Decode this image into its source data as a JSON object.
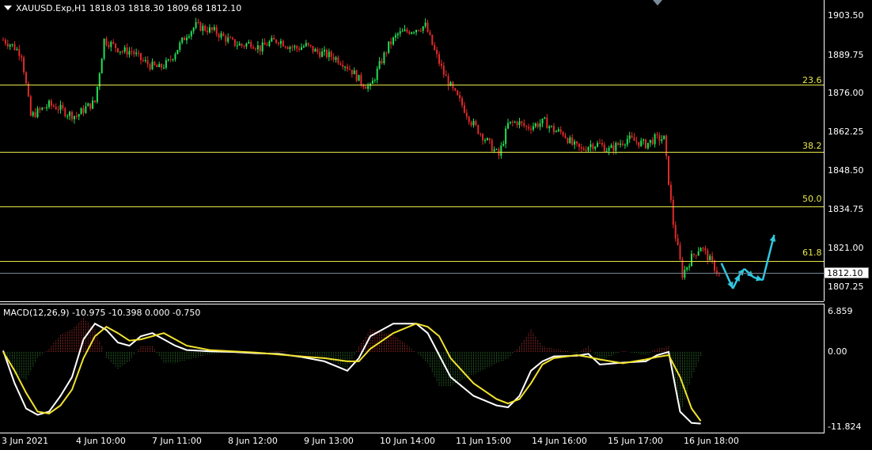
{
  "header": {
    "symbol_info": "XAUUSD.Exp,H1  1818.03 1818.30 1809.68 1812.10"
  },
  "macd_header": "MACD(12,26,9) -10.975 -10.398 0.000 -0.750",
  "price_axis": [
    "1903.50",
    "1889.75",
    "1876.00",
    "1862.25",
    "1848.50",
    "1834.75",
    "1821.00",
    "1807.25"
  ],
  "current_price": "1812.10",
  "macd_axis": [
    "6.859",
    "0.00",
    "-11.824"
  ],
  "time_axis": [
    "3 Jun 2021",
    "4 Jun 10:00",
    "7 Jun 11:00",
    "8 Jun 12:00",
    "9 Jun 13:00",
    "10 Jun 14:00",
    "11 Jun 15:00",
    "14 Jun 16:00",
    "15 Jun 17:00",
    "16 Jun 18:00"
  ],
  "fib_levels": [
    {
      "label": "23.6",
      "price": 1879.2
    },
    {
      "label": "38.2",
      "price": 1855.5
    },
    {
      "label": "50.0",
      "price": 1836.2
    },
    {
      "label": "61.8",
      "price": 1816.9
    }
  ],
  "colors": {
    "background": "#000000",
    "bull": "#22e055",
    "bear": "#e02a2a",
    "fib": "#e8e84a",
    "macd_line": "#ffffff",
    "signal_line": "#f2e22e",
    "forecast_arrow": "#2fc8e0",
    "grid_border": "#ffffff"
  },
  "chart_data": {
    "type": "line",
    "title": "XAUUSD.Exp,H1",
    "price_ylim": [
      1803,
      1908
    ],
    "close_path": [
      [
        0,
        1895
      ],
      [
        4,
        1893
      ],
      [
        8,
        1890
      ],
      [
        12,
        1868
      ],
      [
        16,
        1870
      ],
      [
        20,
        1872
      ],
      [
        24,
        1871
      ],
      [
        28,
        1869
      ],
      [
        32,
        1868
      ],
      [
        36,
        1871
      ],
      [
        40,
        1873
      ],
      [
        44,
        1895
      ],
      [
        48,
        1893
      ],
      [
        52,
        1891
      ],
      [
        56,
        1891
      ],
      [
        60,
        1888
      ],
      [
        64,
        1886
      ],
      [
        68,
        1885
      ],
      [
        72,
        1887
      ],
      [
        76,
        1892
      ],
      [
        80,
        1897
      ],
      [
        84,
        1900
      ],
      [
        88,
        1899
      ],
      [
        92,
        1898
      ],
      [
        96,
        1896
      ],
      [
        100,
        1894
      ],
      [
        104,
        1893
      ],
      [
        108,
        1894
      ],
      [
        112,
        1892
      ],
      [
        116,
        1894
      ],
      [
        120,
        1895
      ],
      [
        124,
        1893
      ],
      [
        128,
        1892
      ],
      [
        132,
        1893
      ],
      [
        136,
        1891
      ],
      [
        140,
        1890
      ],
      [
        144,
        1889
      ],
      [
        148,
        1887
      ],
      [
        152,
        1884
      ],
      [
        156,
        1880
      ],
      [
        160,
        1878
      ],
      [
        164,
        1886
      ],
      [
        168,
        1893
      ],
      [
        172,
        1897
      ],
      [
        176,
        1898
      ],
      [
        180,
        1899
      ],
      [
        184,
        1900
      ],
      [
        188,
        1891
      ],
      [
        192,
        1883
      ],
      [
        196,
        1877
      ],
      [
        200,
        1872
      ],
      [
        204,
        1866
      ],
      [
        208,
        1862
      ],
      [
        212,
        1858
      ],
      [
        216,
        1854
      ],
      [
        220,
        1865
      ],
      [
        224,
        1866
      ],
      [
        228,
        1864
      ],
      [
        232,
        1865
      ],
      [
        236,
        1866
      ],
      [
        240,
        1863
      ],
      [
        244,
        1862
      ],
      [
        248,
        1858
      ],
      [
        252,
        1856
      ],
      [
        256,
        1858
      ],
      [
        260,
        1858
      ],
      [
        264,
        1856
      ],
      [
        268,
        1858
      ],
      [
        272,
        1860
      ],
      [
        276,
        1859
      ],
      [
        280,
        1858
      ],
      [
        284,
        1860
      ],
      [
        288,
        1860
      ],
      [
        292,
        1830
      ],
      [
        296,
        1812
      ],
      [
        300,
        1818
      ],
      [
        304,
        1822
      ],
      [
        308,
        1817
      ],
      [
        312,
        1812
      ]
    ],
    "forecast_path": [
      [
        313,
        1816
      ],
      [
        318,
        1807
      ],
      [
        321,
        1812
      ],
      [
        323,
        1814
      ],
      [
        327,
        1811
      ],
      [
        331,
        1810
      ],
      [
        336,
        1826
      ]
    ],
    "macd": {
      "ylim": [
        -13.5,
        8.5
      ],
      "macd_line": [
        [
          0,
          0.2
        ],
        [
          5,
          -5
        ],
        [
          10,
          -9
        ],
        [
          15,
          -10
        ],
        [
          20,
          -9.5
        ],
        [
          25,
          -7
        ],
        [
          30,
          -4
        ],
        [
          35,
          2
        ],
        [
          40,
          4.5
        ],
        [
          45,
          3.5
        ],
        [
          50,
          1.5
        ],
        [
          55,
          1
        ],
        [
          60,
          2.5
        ],
        [
          65,
          3
        ],
        [
          70,
          2
        ],
        [
          75,
          1
        ],
        [
          80,
          0.3
        ],
        [
          90,
          0.1
        ],
        [
          100,
          0
        ],
        [
          110,
          -0.2
        ],
        [
          120,
          -0.3
        ],
        [
          130,
          -0.8
        ],
        [
          140,
          -1.5
        ],
        [
          150,
          -3
        ],
        [
          155,
          -1
        ],
        [
          160,
          2.5
        ],
        [
          170,
          4.5
        ],
        [
          180,
          4.5
        ],
        [
          185,
          3
        ],
        [
          190,
          -0.5
        ],
        [
          195,
          -4
        ],
        [
          205,
          -7
        ],
        [
          215,
          -8.5
        ],
        [
          220,
          -8.8
        ],
        [
          225,
          -7
        ],
        [
          230,
          -3
        ],
        [
          235,
          -1.5
        ],
        [
          240,
          -0.7
        ],
        [
          250,
          -0.6
        ],
        [
          255,
          -0.3
        ],
        [
          260,
          -2
        ],
        [
          270,
          -1.7
        ],
        [
          280,
          -1.5
        ],
        [
          285,
          -0.5
        ],
        [
          290,
          0
        ],
        [
          295,
          -9.5
        ],
        [
          300,
          -11.3
        ],
        [
          304,
          -11.4
        ]
      ],
      "signal_line": [
        [
          0,
          0
        ],
        [
          5,
          -3
        ],
        [
          10,
          -6.5
        ],
        [
          15,
          -9.5
        ],
        [
          20,
          -9.8
        ],
        [
          25,
          -8.5
        ],
        [
          30,
          -6
        ],
        [
          35,
          -1
        ],
        [
          40,
          2.5
        ],
        [
          45,
          4
        ],
        [
          50,
          3
        ],
        [
          55,
          1.8
        ],
        [
          60,
          2
        ],
        [
          65,
          2.5
        ],
        [
          70,
          3
        ],
        [
          75,
          2
        ],
        [
          80,
          1
        ],
        [
          90,
          0.3
        ],
        [
          100,
          0.1
        ],
        [
          110,
          -0.1
        ],
        [
          120,
          -0.4
        ],
        [
          130,
          -0.7
        ],
        [
          140,
          -1
        ],
        [
          150,
          -1.5
        ],
        [
          155,
          -1.5
        ],
        [
          160,
          0.5
        ],
        [
          170,
          3
        ],
        [
          180,
          4.5
        ],
        [
          185,
          4
        ],
        [
          190,
          2.5
        ],
        [
          195,
          -1
        ],
        [
          205,
          -5
        ],
        [
          215,
          -7.5
        ],
        [
          220,
          -8.2
        ],
        [
          225,
          -7.5
        ],
        [
          230,
          -5
        ],
        [
          235,
          -2
        ],
        [
          240,
          -1
        ],
        [
          250,
          -0.5
        ],
        [
          255,
          -0.8
        ],
        [
          260,
          -1.2
        ],
        [
          270,
          -1.8
        ],
        [
          280,
          -1.2
        ],
        [
          285,
          -0.8
        ],
        [
          290,
          -0.5
        ],
        [
          295,
          -4
        ],
        [
          300,
          -9
        ],
        [
          304,
          -11
        ]
      ]
    }
  }
}
